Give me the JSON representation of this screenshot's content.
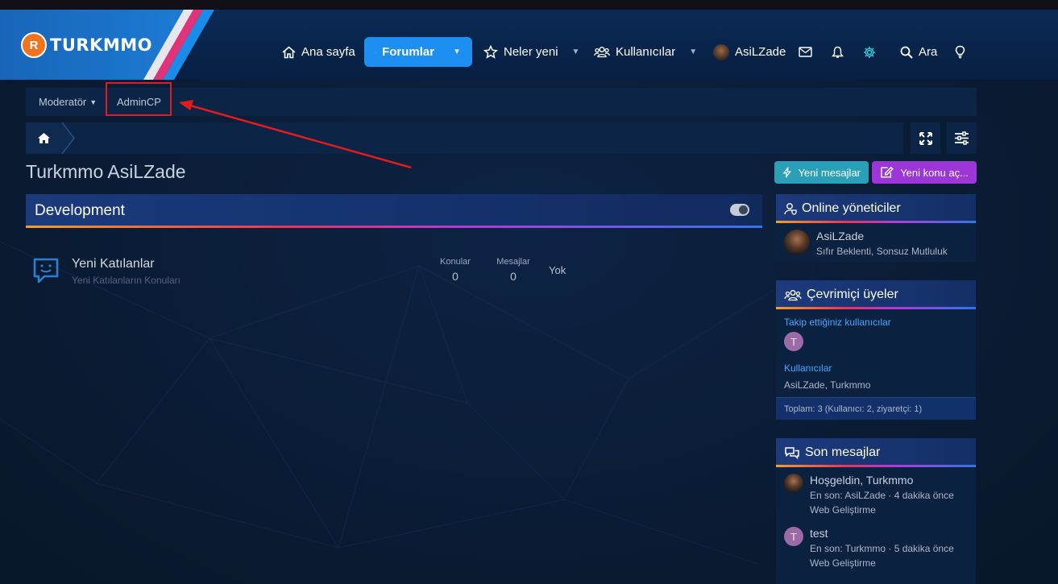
{
  "brand": {
    "logo_text": "TURKMMO",
    "logo_mark": "R"
  },
  "nav": {
    "home": "Ana sayfa",
    "forums": "Forumlar",
    "whats_new": "Neler yeni",
    "members": "Kullanıcılar",
    "user": "AsiLZade",
    "search": "Ara"
  },
  "subnav": {
    "moderator": "Moderatör",
    "admincp": "AdminCP"
  },
  "page": {
    "title": "Turkmmo AsiLZade"
  },
  "buttons": {
    "new_posts": "Yeni mesajlar",
    "new_thread": "Yeni konu aç..."
  },
  "category": {
    "title": "Development"
  },
  "forum": {
    "title": "Yeni Katılanlar",
    "description": "Yeni Katılanların Konuları",
    "threads_label": "Konular",
    "threads_value": "0",
    "posts_label": "Mesajlar",
    "posts_value": "0",
    "last_post": "Yok"
  },
  "widgets": {
    "online_staff": {
      "title": "Online yöneticiler",
      "user": "AsiLZade",
      "user_title": "Sıfır Beklenti, Sonsuz Mutluluk"
    },
    "online_members": {
      "title": "Çevrimiçi üyeler",
      "following_label": "Takip ettiğiniz kullanıcılar",
      "following_avatar": "T",
      "members_label": "Kullanıcılar",
      "members_list": "AsiLZade, Turkmmo",
      "total": "Toplam: 3 (Kullanıcı: 2, ziyaretçi: 1)"
    },
    "latest_posts": {
      "title": "Son mesajlar",
      "items": [
        {
          "title": "Hoşgeldin, Turkmmo",
          "meta": "En son: AsiLZade · 4 dakika önce",
          "forum": "Web Geliştirme",
          "avatar": ""
        },
        {
          "title": "test",
          "meta": "En son: Turkmmo · 5 dakika önce",
          "forum": "Web Geliştirme",
          "avatar": "T"
        }
      ]
    }
  },
  "colors": {
    "accent": "#1d8ff0",
    "teal": "#2aa0b8",
    "purple": "#9d36d8",
    "highlight": "#e31b1b"
  }
}
